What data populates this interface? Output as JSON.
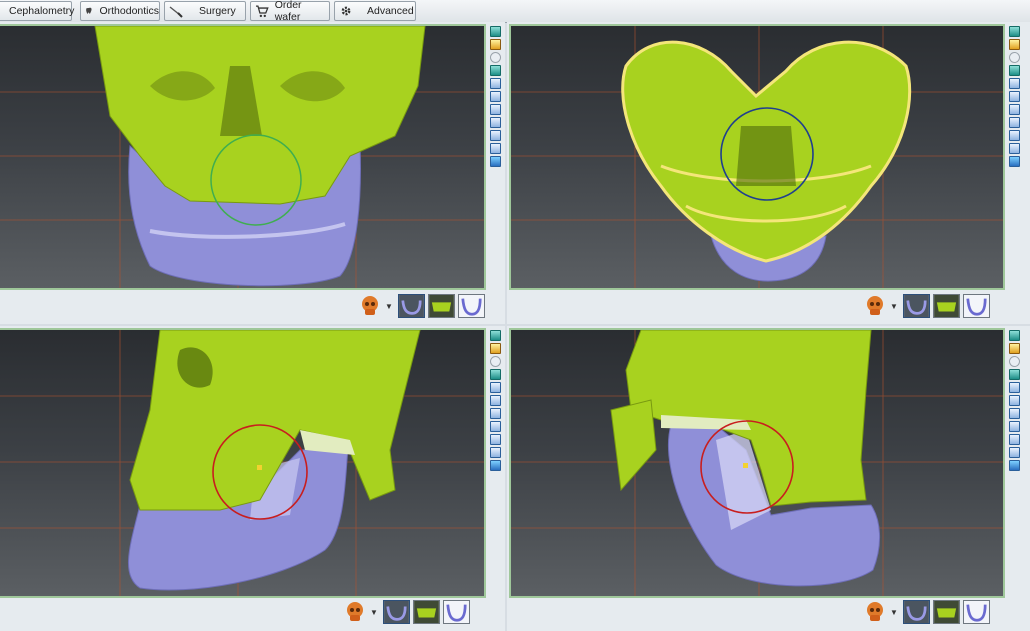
{
  "toolbar": {
    "items": [
      {
        "label": "Cephalometry",
        "icon": "caliper-icon"
      },
      {
        "label": "Orthodontics",
        "icon": "tooth-icon"
      },
      {
        "label": "Surgery",
        "icon": "scalpel-icon"
      },
      {
        "label": "Order wafer",
        "icon": "cart-icon"
      },
      {
        "label": "Advanced",
        "icon": "gear-icon"
      }
    ]
  },
  "viewports": [
    {
      "view": "frontal",
      "marker_color": "#3fae4f"
    },
    {
      "view": "inferior",
      "marker_color": "#1f3f8f"
    },
    {
      "view": "right-lateral",
      "marker_color": "#c81e1e"
    },
    {
      "view": "left-lateral",
      "marker_color": "#c81e1e"
    }
  ],
  "colors": {
    "maxilla": "#a8d21f",
    "mandible": "#8f8fd8",
    "grid_line": "#b2522e",
    "viewport_border": "#9fc79a"
  },
  "view_bar": {
    "selector_icon": "skull-icon",
    "thumbnails": [
      "mandible-thumbnail",
      "maxilla-thumbnail",
      "mandible-outline-thumbnail"
    ]
  }
}
